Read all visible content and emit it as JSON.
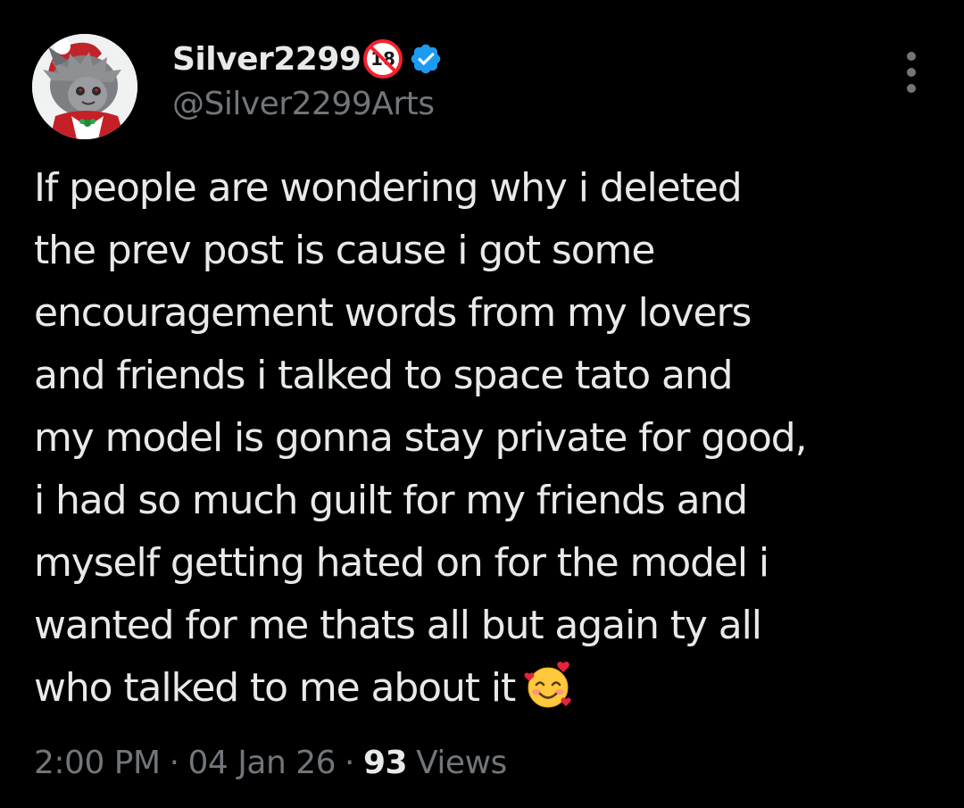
{
  "user": {
    "display_name": "Silver2299",
    "handle": "@Silver2299Arts",
    "badge_adult_text": "18",
    "verified": true,
    "verified_color": "#1d9bf0",
    "adult_badge_color": "#f4212e"
  },
  "icons": {
    "more": "more-vertical-icon",
    "verified": "verified-badge-icon",
    "adult": "no-under-18-icon",
    "emoji": "smiling-face-with-hearts-emoji"
  },
  "tweet": {
    "lines": [
      "If people are wondering why i deleted",
      "the prev post is cause i got some",
      "encouragement words from my lovers",
      "and friends i talked to space tato and",
      "my model is gonna stay private for good,",
      "i had so much guilt for my friends and",
      "myself getting hated on for the model i",
      "wanted for me thats all but again ty all",
      "who talked to me about it"
    ],
    "time": "2:00 PM",
    "date": "04 Jan 26",
    "separator": "·",
    "views_count": "93",
    "views_label": "Views"
  },
  "colors": {
    "background": "#000000",
    "primary_text": "#e7e9ea",
    "secondary_text": "#71767b"
  }
}
